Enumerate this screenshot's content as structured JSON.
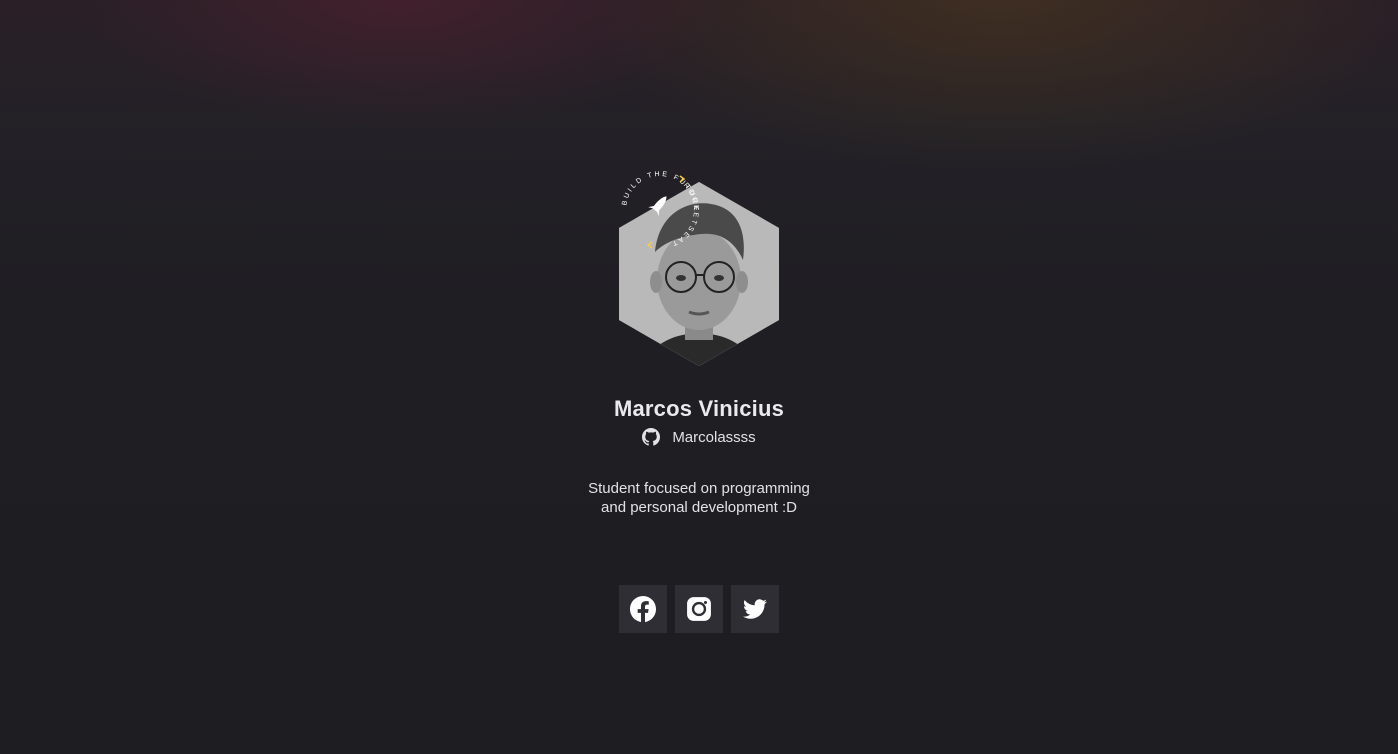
{
  "profile": {
    "name": "Marcos Vinicius",
    "github_username": "Marcolassss",
    "bio_line_1": "Student focused on programming",
    "bio_line_2": "and personal development :D",
    "badge_text_top": "BUILD THE FUTURE",
    "badge_text_side": "ROCKETSEAT"
  },
  "socials": [
    {
      "name": "facebook",
      "icon": "facebook-icon"
    },
    {
      "name": "instagram",
      "icon": "instagram-icon"
    },
    {
      "name": "twitter",
      "icon": "twitter-icon"
    }
  ],
  "colors": {
    "background": "#1e1d22",
    "button": "#2f2e34",
    "text": "#e1e1e6",
    "accent": "#f7c948"
  }
}
